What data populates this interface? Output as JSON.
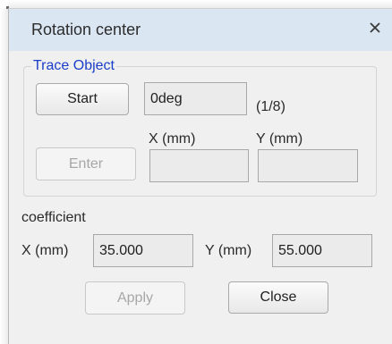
{
  "dialog": {
    "title": "Rotation center",
    "close_icon": "close-icon"
  },
  "trace_group": {
    "legend": "Trace Object",
    "start_button": "Start",
    "angle_value": "0deg",
    "counter": "(1/8)",
    "enter_button": "Enter",
    "x_label": "X (mm)",
    "y_label": "Y (mm)",
    "x_value": "",
    "y_value": ""
  },
  "coefficient": {
    "label": "coefficient",
    "x_label": "X (mm)",
    "x_value": "35.000",
    "y_label": "Y (mm)",
    "y_value": "55.000"
  },
  "footer": {
    "apply_button": "Apply",
    "close_button": "Close"
  },
  "colors": {
    "titlebar": "#dbe6f3",
    "legend": "#1a3ec8",
    "window_bg": "#f0f0f0"
  }
}
